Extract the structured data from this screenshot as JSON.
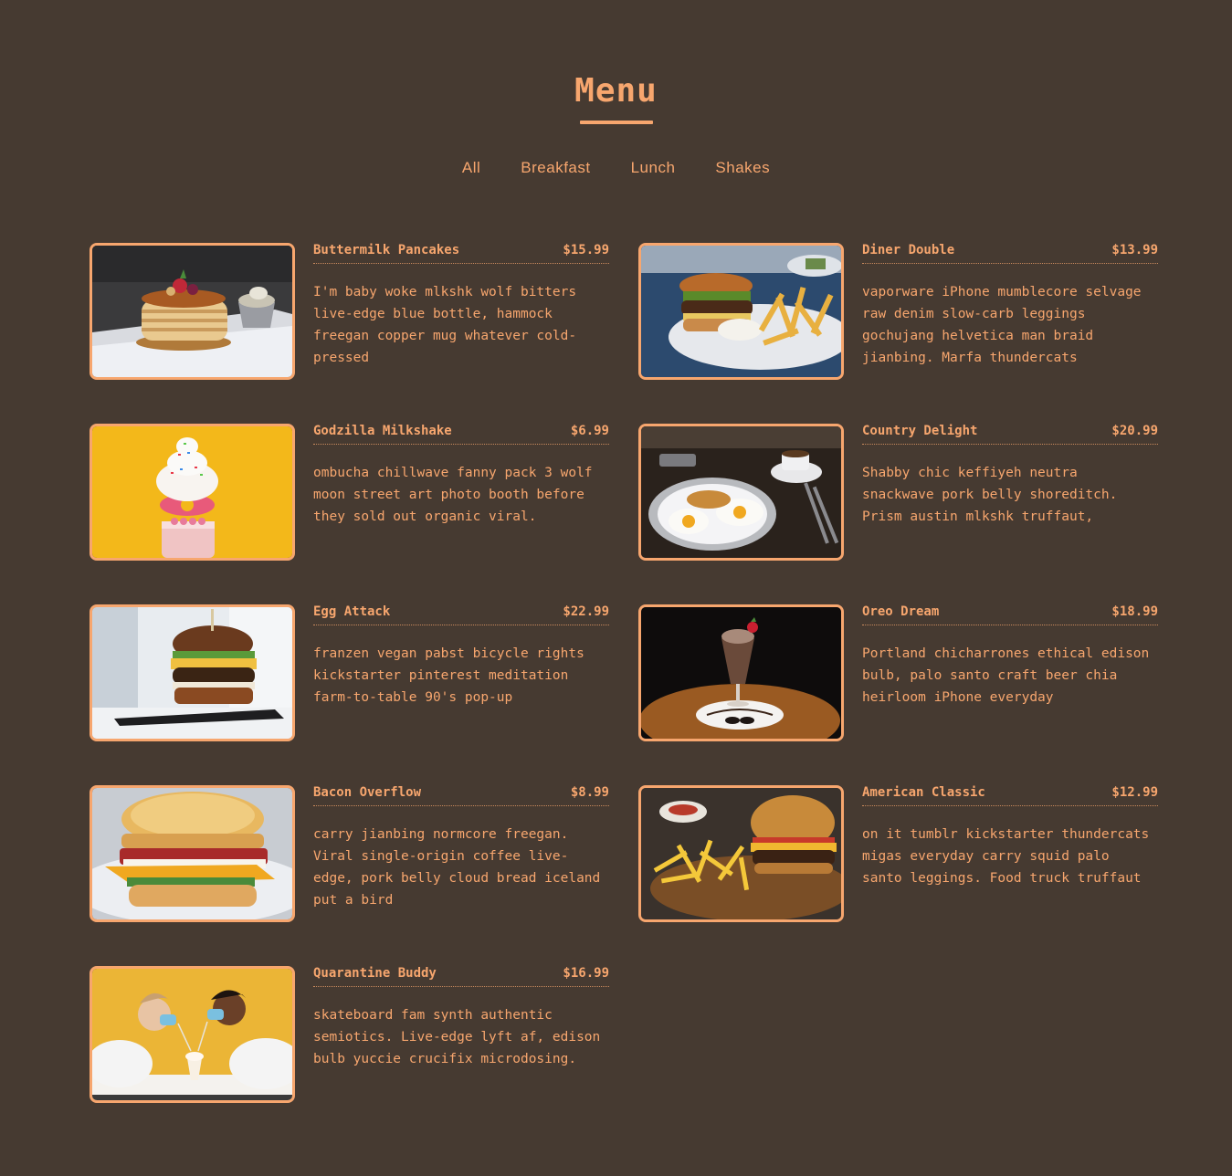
{
  "header": {
    "title": "Menu"
  },
  "filters": [
    {
      "label": "All"
    },
    {
      "label": "Breakfast"
    },
    {
      "label": "Lunch"
    },
    {
      "label": "Shakes"
    }
  ],
  "items": [
    {
      "name": "Buttermilk Pancakes",
      "price": "$15.99",
      "desc": "I'm baby woke mlkshk wolf bitters live-edge blue bottle, hammock freegan copper mug whatever cold-pressed",
      "photo": "pancakes"
    },
    {
      "name": "Diner Double",
      "price": "$13.99",
      "desc": "vaporware iPhone mumblecore selvage raw denim slow-carb leggings gochujang helvetica man braid jianbing. Marfa thundercats",
      "photo": "burger-fries-plate"
    },
    {
      "name": "Godzilla Milkshake",
      "price": "$6.99",
      "desc": "ombucha chillwave fanny pack 3 wolf moon street art photo booth before they sold out organic viral.",
      "photo": "milkshake-yellow"
    },
    {
      "name": "Country Delight",
      "price": "$20.99",
      "desc": "Shabby chic keffiyeh neutra snackwave pork belly shoreditch. Prism austin mlkshk truffaut,",
      "photo": "eggs-plate"
    },
    {
      "name": "Egg Attack",
      "price": "$22.99",
      "desc": "franzen vegan pabst bicycle rights kickstarter pinterest meditation farm-to-table 90's pop-up",
      "photo": "egg-burger"
    },
    {
      "name": "Oreo Dream",
      "price": "$18.99",
      "desc": "Portland chicharrones ethical edison bulb, palo santo craft beer chia heirloom iPhone everyday",
      "photo": "oreo-shake"
    },
    {
      "name": "Bacon Overflow",
      "price": "$8.99",
      "desc": "carry jianbing normcore freegan. Viral single-origin coffee live-edge, pork belly cloud bread iceland put a bird",
      "photo": "bacon-biscuit"
    },
    {
      "name": "American Classic",
      "price": "$12.99",
      "desc": "on it tumblr kickstarter thundercats migas everyday carry squid palo santo leggings. Food truck truffaut",
      "photo": "classic-burger"
    },
    {
      "name": "Quarantine Buddy",
      "price": "$16.99",
      "desc": "skateboard fam synth authentic semiotics. Live-edge lyft af, edison bulb yuccie crucifix microdosing.",
      "photo": "couple-shake"
    }
  ],
  "colors": {
    "background": "#463a31",
    "accent": "#f7a66e"
  }
}
